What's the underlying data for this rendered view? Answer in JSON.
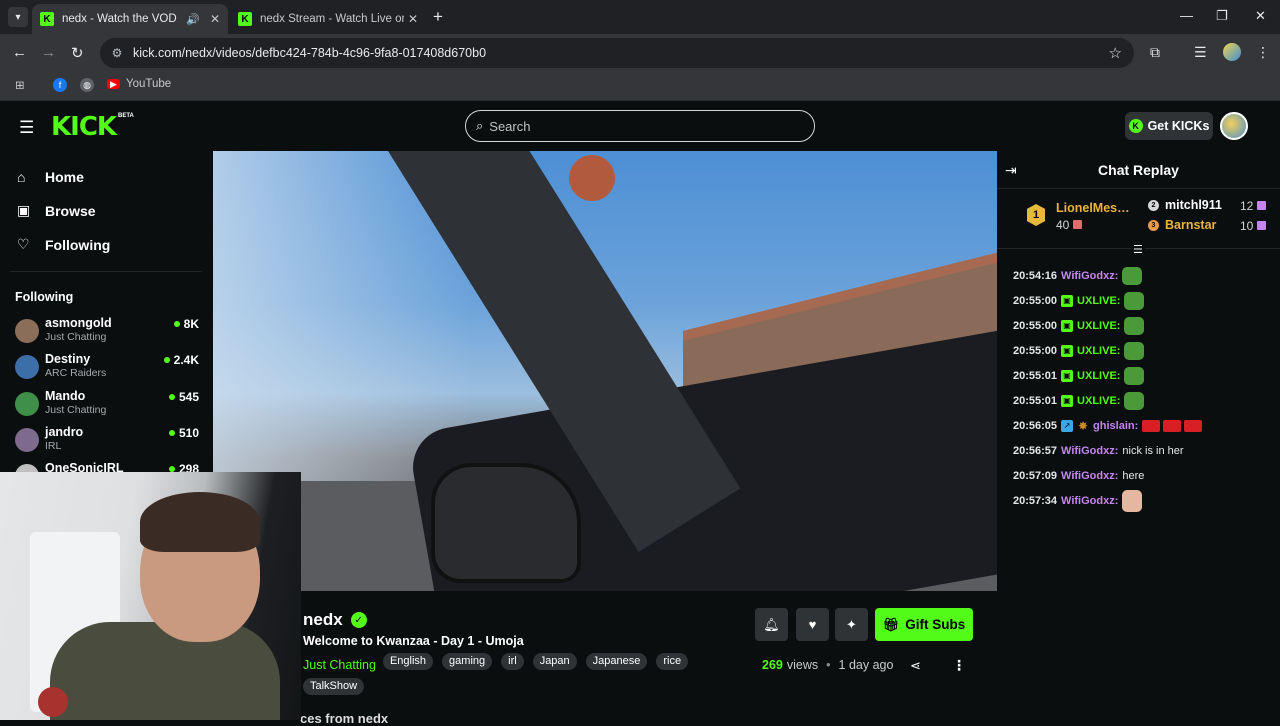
{
  "browser": {
    "tabs": [
      {
        "title": "nedx - Watch the VOD on Ki",
        "active": true
      },
      {
        "title": "nedx Stream - Watch Live on Ki",
        "active": false
      }
    ],
    "url": "kick.com/nedx/videos/defbc424-784b-4c96-9fa8-017408d670b0",
    "bookmarks": [
      {
        "label": "YouTube"
      }
    ]
  },
  "header": {
    "logo": "KICK",
    "beta": "BETA",
    "search_placeholder": "Search",
    "get_kicks": "Get KICKs"
  },
  "sidebar": {
    "nav": [
      {
        "label": "Home",
        "icon": "home-icon"
      },
      {
        "label": "Browse",
        "icon": "browse-icon"
      },
      {
        "label": "Following",
        "icon": "heart-icon"
      }
    ],
    "following_title": "Following",
    "channels": [
      {
        "name": "asmongold",
        "category": "Just Chatting",
        "viewers": "8K",
        "color": "#8a6e5a"
      },
      {
        "name": "Destiny",
        "category": "ARC Raiders",
        "viewers": "2.4K",
        "color": "#3c6ea8"
      },
      {
        "name": "Mando",
        "category": "Just Chatting",
        "viewers": "545",
        "color": "#3f8e4a"
      },
      {
        "name": "jandro",
        "category": "IRL",
        "viewers": "510",
        "color": "#7d6a8c"
      },
      {
        "name": "OneSonicIRL",
        "category": "",
        "viewers": "298",
        "color": "#c0c0c0"
      }
    ]
  },
  "stream": {
    "streamer": "nedx",
    "title": "Welcome to Kwanzaa - Day 1 - Umoja",
    "category": "Just Chatting",
    "tags": [
      "English",
      "gaming",
      "irl",
      "Japan",
      "Japanese",
      "rice",
      "TalkShow"
    ],
    "gift_subs": "Gift Subs",
    "views": "269",
    "views_label": "views",
    "age": "1 day ago",
    "below_heading": "ces from nedx"
  },
  "chat": {
    "title": "Chat Replay",
    "leaderboard": [
      {
        "rank": "1",
        "name": "LionelMessi...",
        "count": "40"
      },
      {
        "rank": "2",
        "name": "mitchl911",
        "count": "12"
      },
      {
        "rank": "3",
        "name": "Barnstar",
        "count": "10"
      }
    ],
    "messages": [
      {
        "time": "20:54:16",
        "user": "WifiGodxz:",
        "text": "",
        "user_color": "#c584f2",
        "badge": "",
        "emotes": [
          "frog"
        ]
      },
      {
        "time": "20:55:00",
        "user": "UXLIVE:",
        "text": "",
        "user_color": "#53fc18",
        "badge": "gift",
        "emotes": [
          "frog"
        ]
      },
      {
        "time": "20:55:00",
        "user": "UXLIVE:",
        "text": "",
        "user_color": "#53fc18",
        "badge": "gift",
        "emotes": [
          "frog"
        ]
      },
      {
        "time": "20:55:00",
        "user": "UXLIVE:",
        "text": "",
        "user_color": "#53fc18",
        "badge": "gift",
        "emotes": [
          "frog"
        ]
      },
      {
        "time": "20:55:01",
        "user": "UXLIVE:",
        "text": "",
        "user_color": "#53fc18",
        "badge": "gift",
        "emotes": [
          "frog"
        ]
      },
      {
        "time": "20:55:01",
        "user": "UXLIVE:",
        "text": "",
        "user_color": "#53fc18",
        "badge": "gift",
        "emotes": [
          "frog"
        ]
      },
      {
        "time": "20:56:05",
        "user": "ghislain:",
        "text": "",
        "user_color": "#c584f2",
        "badge": "sub",
        "emotes": [
          "flag",
          "flag",
          "flag"
        ]
      },
      {
        "time": "20:56:57",
        "user": "WifiGodxz:",
        "text": "nick is in her",
        "user_color": "#c584f2",
        "badge": "",
        "emotes": []
      },
      {
        "time": "20:57:09",
        "user": "WifiGodxz:",
        "text": "here",
        "user_color": "#c584f2",
        "badge": "",
        "emotes": []
      },
      {
        "time": "20:57:34",
        "user": "WifiGodxz:",
        "text": "",
        "user_color": "#c584f2",
        "badge": "",
        "emotes": [
          "face"
        ]
      }
    ]
  },
  "colors": {
    "brand": "#53fc18",
    "gold": "#e9b33e",
    "purple": "#c584f2"
  }
}
